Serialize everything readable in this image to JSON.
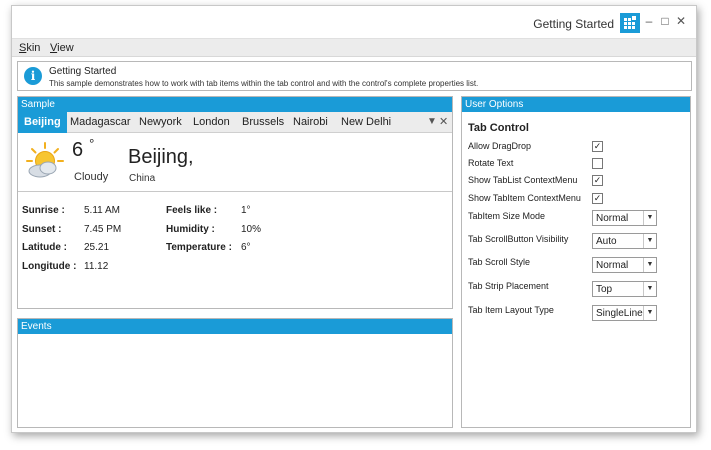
{
  "window": {
    "title": "Getting Started"
  },
  "menu": [
    {
      "label": "Skin",
      "accel": "S",
      "rest": "kin"
    },
    {
      "label": "View",
      "accel": "V",
      "rest": "iew"
    }
  ],
  "info": {
    "title": "Getting Started",
    "description": "This sample demonstrates how to work with tab items within the tab control and with the control's complete properties list."
  },
  "sample": {
    "header": "Sample",
    "tabs": [
      "Beijing",
      "Madagascar",
      "Newyork",
      "London",
      "Brussels",
      "Nairobi",
      "New Delhi"
    ],
    "active_tab": 0,
    "weather": {
      "temperature": "6",
      "degree": "°",
      "condition": "Cloudy",
      "city": "Beijing,",
      "country": "China",
      "icon": "sun-cloud-icon"
    },
    "details": {
      "sunrise_label": "Sunrise :",
      "sunrise": "5.11 AM",
      "sunset_label": "Sunset :",
      "sunset": "7.45 PM",
      "latitude_label": "Latitude :",
      "latitude": "25.21",
      "longitude_label": "Longitude :",
      "longitude": "11.12",
      "feels_label": "Feels like :",
      "feels": "1°",
      "humidity_label": "Humidity :",
      "humidity": "10%",
      "temperature_label": "Temperature :",
      "temperature": "6°"
    }
  },
  "events": {
    "header": "Events"
  },
  "options": {
    "header": "User Options",
    "section_title": "Tab Control",
    "checkboxes": [
      {
        "label": "Allow DragDrop",
        "checked": true
      },
      {
        "label": "Rotate Text",
        "checked": false
      },
      {
        "label": "Show TabList ContextMenu",
        "checked": true
      },
      {
        "label": "Show TabItem ContextMenu",
        "checked": true
      }
    ],
    "combos": [
      {
        "label": "TabItem Size Mode",
        "value": "Normal"
      },
      {
        "label": "Tab ScrollButton Visibility",
        "value": "Auto"
      },
      {
        "label": "Tab Scroll Style",
        "value": "Normal"
      },
      {
        "label": "Tab Strip Placement",
        "value": "Top"
      },
      {
        "label": "Tab Item Layout Type",
        "value": "SingleLine"
      }
    ]
  },
  "colors": {
    "accent": "#1a9bd7",
    "panel_border": "#b8b8b8",
    "menubar": "#ececec"
  }
}
